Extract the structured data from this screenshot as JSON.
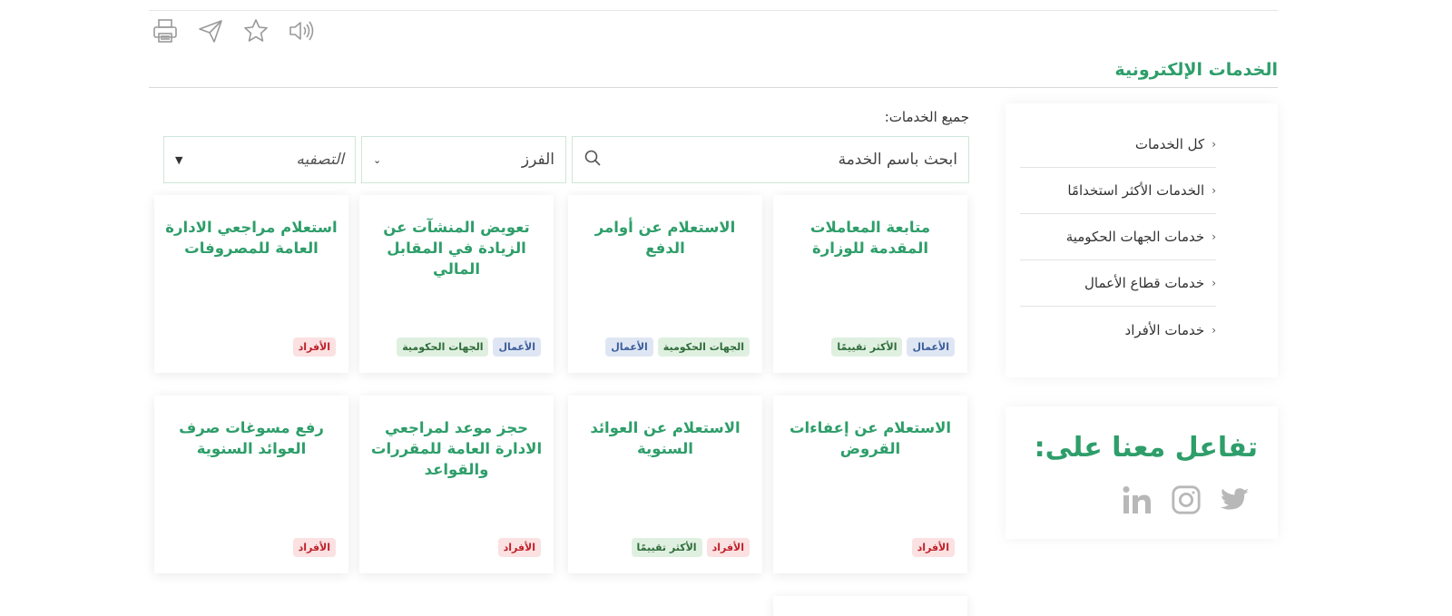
{
  "section_title": "الخدمات الإلكترونية",
  "toolbar": {
    "icons": [
      "print-icon",
      "send-icon",
      "star-icon",
      "speaker-icon"
    ]
  },
  "sidebar": {
    "items": [
      {
        "label": "كل الخدمات"
      },
      {
        "label": "الخدمات الأكثر استخدامًا"
      },
      {
        "label": "خدمات الجهات الحكومية"
      },
      {
        "label": "خدمات قطاع الأعمال"
      },
      {
        "label": "خدمات الأفراد"
      }
    ]
  },
  "social": {
    "title": "تفاعل معنا على:",
    "icons": [
      "linkedin-icon",
      "instagram-icon",
      "twitter-icon"
    ]
  },
  "main": {
    "all_label": "جميع الخدمات:",
    "search_placeholder": "ابحث باسم الخدمة",
    "order_value": "الفرز",
    "filter_value": "التصفيه"
  },
  "cards": [
    {
      "title": "متابعة المعاملات المقدمة للوزارة",
      "tags": [
        {
          "text": "الأعمال",
          "kind": "biz"
        },
        {
          "text": "الأكثر تقييمًا",
          "kind": "top"
        }
      ]
    },
    {
      "title": "الاستعلام عن أوامر الدفع",
      "tags": [
        {
          "text": "الجهات الحكومية",
          "kind": "gov"
        },
        {
          "text": "الأعمال",
          "kind": "biz"
        }
      ]
    },
    {
      "title": "تعويض المنشآت عن الزيادة في المقابل المالي",
      "tags": [
        {
          "text": "الأعمال",
          "kind": "biz"
        },
        {
          "text": "الجهات الحكومية",
          "kind": "gov"
        }
      ]
    },
    {
      "title": "استعلام مراجعي الادارة العامة للمصروفات",
      "tags": [
        {
          "text": "الأفراد",
          "kind": "ind"
        }
      ]
    },
    {
      "title": "الاستعلام عن إعفاءات القروض",
      "tags": [
        {
          "text": "الأفراد",
          "kind": "ind"
        }
      ]
    },
    {
      "title": "الاستعلام عن العوائد السنوية",
      "tags": [
        {
          "text": "الأفراد",
          "kind": "ind"
        },
        {
          "text": "الأكثر تقييمًا",
          "kind": "top"
        }
      ]
    },
    {
      "title": "حجز موعد لمراجعي الادارة العامة للمقررات والقواعد",
      "tags": [
        {
          "text": "الأفراد",
          "kind": "ind"
        }
      ]
    },
    {
      "title": "رفع مسوغات صرف العوائد السنوية",
      "tags": [
        {
          "text": "الأفراد",
          "kind": "ind"
        }
      ]
    },
    {
      "title": "",
      "tags": []
    }
  ]
}
